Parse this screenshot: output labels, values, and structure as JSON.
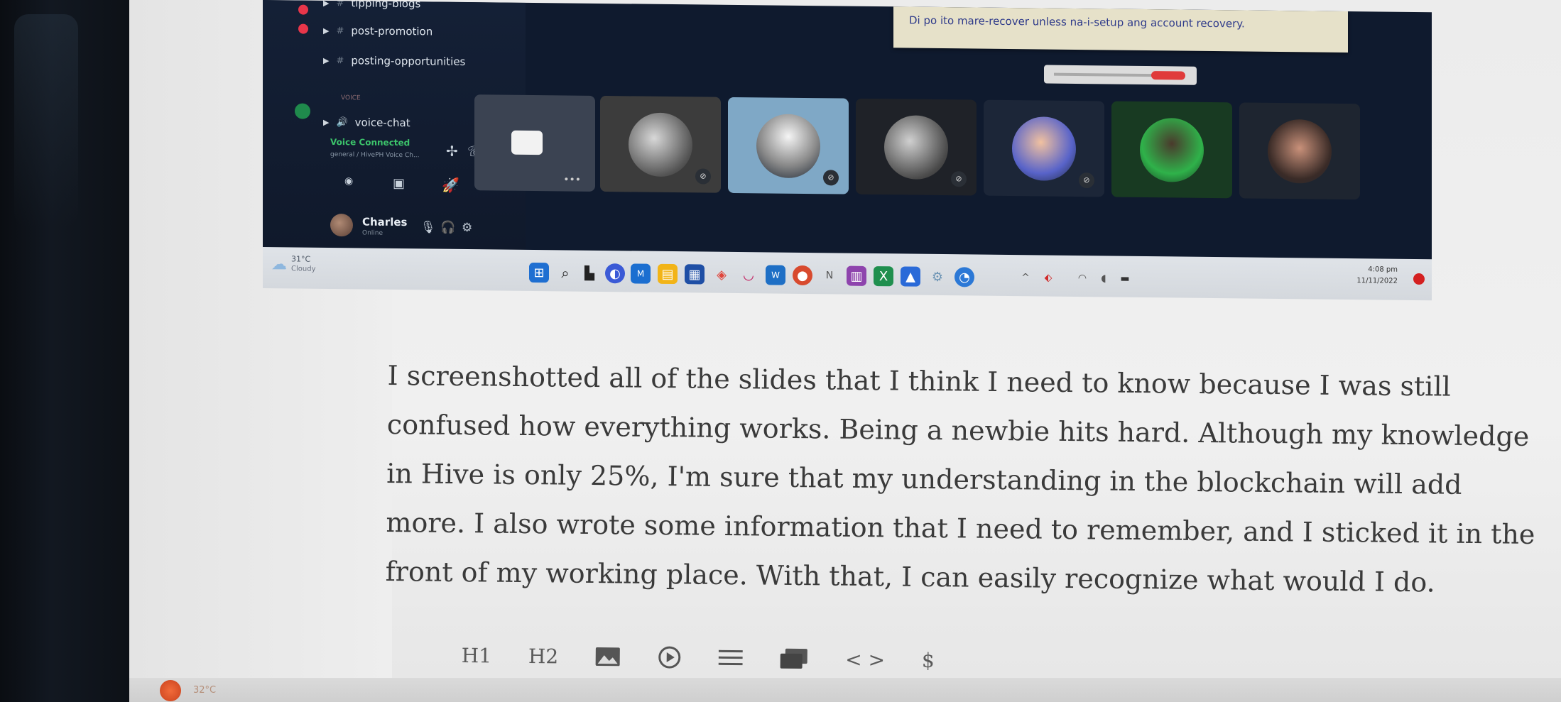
{
  "discord": {
    "channels": [
      {
        "label": "tipping-blogs"
      },
      {
        "label": "post-promotion"
      },
      {
        "label": "posting-opportunities"
      },
      {
        "label": "VOICE"
      },
      {
        "label": "voice-chat"
      }
    ],
    "voice_status": "Voice Connected",
    "voice_sub": "general / HivePH Voice Ch...",
    "user": {
      "name": "Charles",
      "status": "Online"
    }
  },
  "notice": {
    "text": "Di po ito mare-recover unless na-i-setup ang account recovery."
  },
  "taskbar": {
    "weather_temp": "31°C",
    "weather_cond": "Cloudy",
    "tray_time": "4:08 pm",
    "tray_date": "11/11/2022"
  },
  "article": {
    "lines": [
      "I screenshotted all of the slides that I think I need to know because I was still",
      "confused how everything works. Being a newbie hits hard. Although my knowledge",
      "in Hive is only 25%, I'm sure that my understanding in the blockchain will add",
      "more. I also wrote some information that I need to remember, and I sticked it in the",
      "front of my working place. With that, I can easily recognize what would I do."
    ]
  },
  "toolbar": {
    "h1": "H1",
    "h2": "H2",
    "image_icon": "image-icon",
    "video_icon": "video-icon",
    "list_icon": "list-icon",
    "gallery_icon": "gallery-icon",
    "code": "< >",
    "dollar": "$"
  },
  "bottom": {
    "temp": "32°C"
  },
  "colors": {
    "discord_bg": "#0f1a2e",
    "voice_green": "#3cc46b",
    "notice_bg": "#e6e1c9",
    "text": "#3a3a3a"
  }
}
